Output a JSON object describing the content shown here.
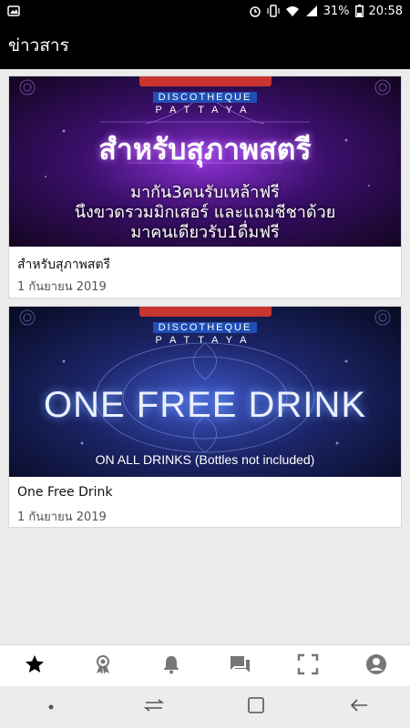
{
  "status_bar": {
    "battery": "31%",
    "time": "20:58"
  },
  "app_bar": {
    "title": "ข่าวสาร"
  },
  "cards": [
    {
      "title": "สำหรับสุภาพสตรี",
      "date": "1 กันยายน 2019",
      "banner": {
        "brand_top": "DISCOTHEQUE",
        "brand_city": "PATTAYA",
        "heading": "สำหรับสุภาพสตรี",
        "lines": [
          "มากัน3คนรับเหล้าฟรี",
          "นึงขวดรวมมิกเสอร์ และแถมชีชาด้วย",
          "มาคนเดียวรับ1ดื่มฟรี"
        ]
      }
    },
    {
      "title": "One Free Drink",
      "date": "1 กันยายน 2019",
      "banner": {
        "brand_top": "DISCOTHEQUE",
        "brand_city": "PATTAYA",
        "heading": "ONE FREE DRINK",
        "sub": "ON ALL DRINKS (Bottles not included)"
      }
    }
  ],
  "bottom_nav": {
    "items": [
      "star-icon",
      "award-icon",
      "bell-icon",
      "chat-icon",
      "scan-icon",
      "account-icon"
    ]
  },
  "colors": {
    "app_bar": "#000000",
    "background": "#ececec"
  }
}
